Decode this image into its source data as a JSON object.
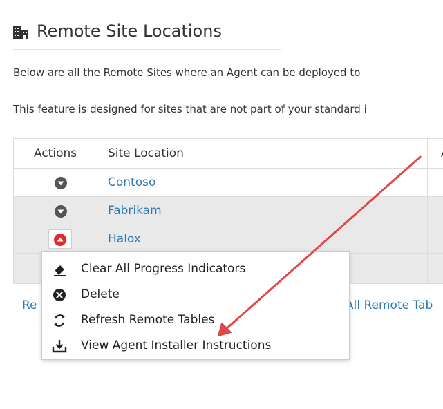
{
  "header": {
    "title": "Remote Site Locations",
    "icon": "building-icon"
  },
  "description": {
    "line1": "Below are all the Remote Sites where an Agent can be deployed to",
    "line2": "This feature is designed for sites that are not part of your standard i"
  },
  "table": {
    "columns": [
      "Actions",
      "Site Location",
      "A"
    ],
    "rows": [
      {
        "site": "Contoso",
        "menu_open": false
      },
      {
        "site": "Fabrikam",
        "menu_open": false
      },
      {
        "site": "Halox",
        "menu_open": true
      }
    ]
  },
  "below": {
    "left_text": "Re",
    "right_text": "All Remote Tab"
  },
  "context_menu": {
    "items": [
      {
        "label": "Clear All Progress Indicators",
        "icon": "eraser-icon"
      },
      {
        "label": "Delete",
        "icon": "delete-circle-icon"
      },
      {
        "label": "Refresh Remote Tables",
        "icon": "refresh-icon"
      },
      {
        "label": "View Agent Installer Instructions",
        "icon": "download-tray-icon"
      }
    ]
  },
  "colors": {
    "link": "#2a7ab7",
    "action_button": "#555555",
    "action_button_active": "#e8262d",
    "annotation_arrow": "#e04848",
    "row_alt": "#e9e9e9"
  }
}
